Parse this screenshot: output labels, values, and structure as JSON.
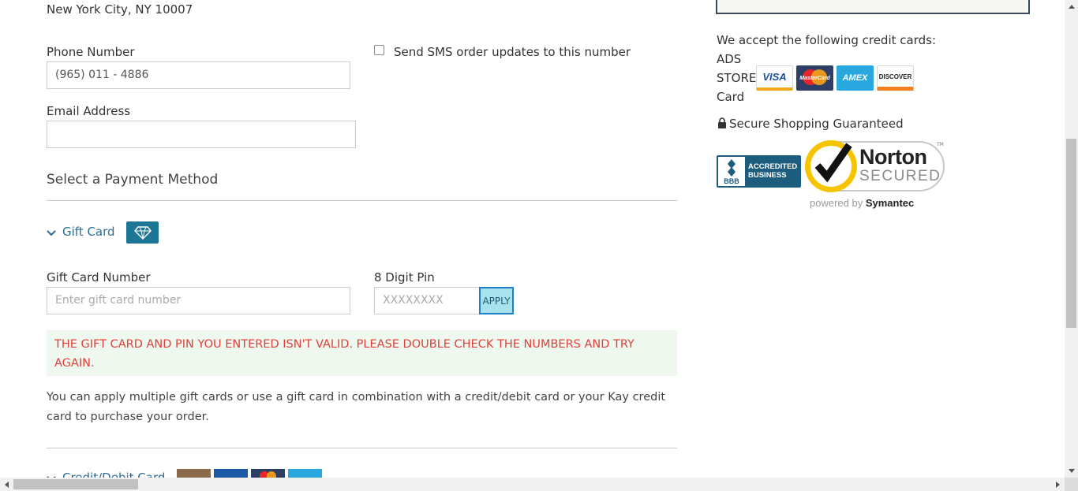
{
  "address_line": "New York City, NY 10007",
  "phone": {
    "label": "Phone Number",
    "value": "(965) 011 - 4886",
    "sms_label": "Send SMS order updates to this number"
  },
  "email": {
    "label": "Email Address",
    "value": ""
  },
  "payment": {
    "heading": "Select a Payment Method",
    "gift_card": {
      "toggle_label": "Gift Card",
      "number_label": "Gift Card Number",
      "number_placeholder": "Enter gift card number",
      "pin_label": "8 Digit Pin",
      "pin_placeholder": "XXXXXXXX",
      "apply_label": "APPLY",
      "error": "THE GIFT CARD AND PIN YOU ENTERED ISN'T VALID. PLEASE DOUBLE CHECK THE NUMBERS AND TRY AGAIN.",
      "info": "You can apply multiple gift cards or use a gift card in combination with a credit/debit card or your Kay credit card to purchase your order."
    },
    "credit_card": {
      "toggle_label": "Credit/Debit Card"
    }
  },
  "sidebar": {
    "accept_text": "We accept the following credit cards:",
    "card_word_lines": [
      "ADS",
      "STORE",
      "Card"
    ],
    "card_logos": [
      "VISA",
      "MasterCard",
      "AMEX",
      "DISCOVER"
    ],
    "secure_text": "Secure Shopping Guaranteed",
    "bbb": {
      "mark": "BBB",
      "line1": "ACCREDITED",
      "line2": "BUSINESS"
    },
    "norton": {
      "line1": "Norton",
      "line2": "SECURED",
      "tm": "TM",
      "powered_prefix": "powered by ",
      "powered_brand": "Symantec"
    }
  },
  "colors": {
    "link": "#2b6a94",
    "error_text": "#e0403b",
    "error_bg": "#eef8ee",
    "apply_bg": "#a9e2ef",
    "apply_border": "#1f7fc4",
    "gift_badge": "#1e7696",
    "norton_yellow": "#f6c500"
  }
}
